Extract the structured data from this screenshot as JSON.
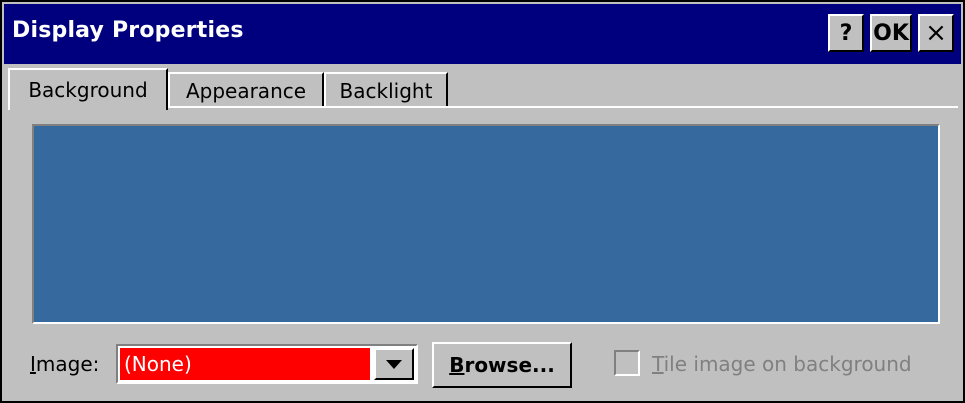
{
  "window": {
    "title": "Display Properties",
    "buttons": {
      "help": "?",
      "ok": "OK",
      "close": "×"
    }
  },
  "tabs": [
    {
      "label": "Background",
      "active": true
    },
    {
      "label": "Appearance",
      "active": false
    },
    {
      "label": "Backlight",
      "active": false
    }
  ],
  "preview": {
    "color": "#366a9e"
  },
  "image": {
    "label_mnemonic": "I",
    "label_rest": "mage:",
    "value": "(None)"
  },
  "browse": {
    "label_mnemonic": "B",
    "label_rest": "rowse..."
  },
  "tile": {
    "label_mnemonic": "T",
    "label_rest": "ile image on background",
    "checked": false,
    "enabled": false
  },
  "colors": {
    "titlebar": "#00007f",
    "face": "#c0c0c0",
    "selection": "#ff0000"
  }
}
